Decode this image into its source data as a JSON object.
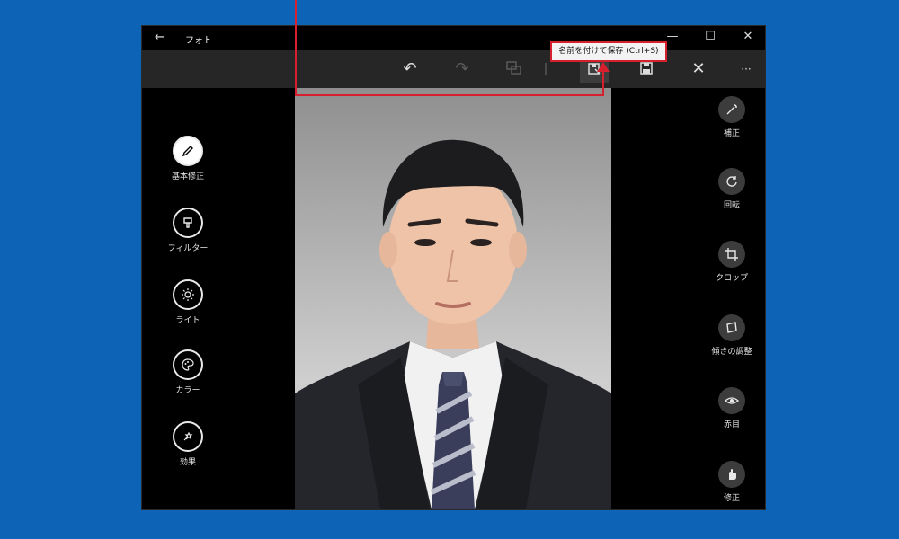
{
  "window": {
    "title": "フォト",
    "back_glyph": "←",
    "min_glyph": "—",
    "max_glyph": "☐",
    "close_glyph": "✕"
  },
  "toolbar": {
    "buttons": [
      {
        "name": "undo-button",
        "icon": "undo-icon",
        "glyph": "↶",
        "enabled": true
      },
      {
        "name": "redo-button",
        "icon": "redo-icon",
        "glyph": "↷",
        "enabled": false
      },
      {
        "name": "compare-button",
        "icon": "compare-icon",
        "glyph": "⧉",
        "enabled": false
      },
      {
        "name": "save-copy-button",
        "icon": "save-copy-icon",
        "glyph": "⎘",
        "enabled": true
      },
      {
        "name": "save-button",
        "icon": "save-icon",
        "glyph": "💾",
        "enabled": true
      },
      {
        "name": "close-editor-button",
        "icon": "close-icon",
        "glyph": "✕",
        "enabled": true
      },
      {
        "name": "more-button",
        "icon": "more-icon",
        "glyph": "···",
        "enabled": true
      }
    ]
  },
  "tooltip": {
    "text": "名前を付けて保存 (Ctrl+S)"
  },
  "left_tools": [
    {
      "label": "基本修正",
      "icon": "pencil-icon",
      "active": true
    },
    {
      "label": "フィルター",
      "icon": "filter-icon",
      "active": false
    },
    {
      "label": "ライト",
      "icon": "light-icon",
      "active": false
    },
    {
      "label": "カラー",
      "icon": "color-palette-icon",
      "active": false
    },
    {
      "label": "効果",
      "icon": "effects-icon",
      "active": false
    }
  ],
  "right_tools": [
    {
      "label": "補正",
      "icon": "magic-wand-icon"
    },
    {
      "label": "回転",
      "icon": "rotate-icon"
    },
    {
      "label": "クロップ",
      "icon": "crop-icon"
    },
    {
      "label": "傾きの調整",
      "icon": "straighten-icon"
    },
    {
      "label": "赤目",
      "icon": "red-eye-icon"
    },
    {
      "label": "修正",
      "icon": "spot-fix-icon"
    }
  ],
  "colors": {
    "desktop": "#0d63b5",
    "highlight": "#d6202e",
    "toolbar": "#262626"
  }
}
